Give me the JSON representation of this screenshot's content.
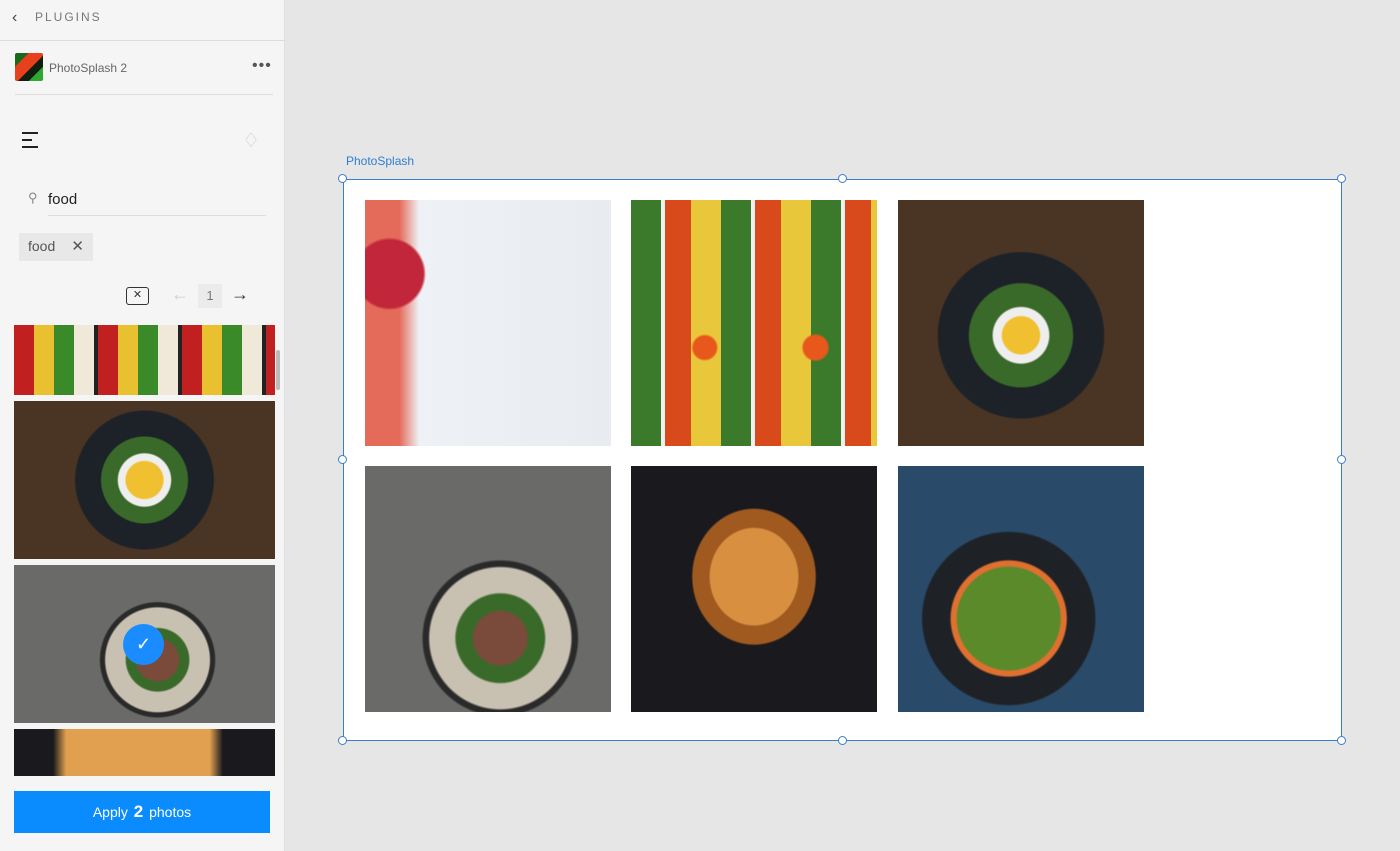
{
  "sidebar": {
    "back_label": "PLUGINS",
    "plugin_name": "PhotoSplash 2",
    "more_label": "•••",
    "search": {
      "value": "food",
      "placeholder": ""
    },
    "tags": [
      {
        "label": "food"
      }
    ],
    "pagination": {
      "current_page": "1"
    },
    "thumbnails": [
      {
        "selected": false
      },
      {
        "selected": false
      },
      {
        "selected": true
      },
      {
        "selected": false
      }
    ],
    "apply": {
      "prefix": "Apply",
      "count": "2",
      "suffix": "photos"
    }
  },
  "canvas": {
    "artboard_label": "PhotoSplash",
    "photos": [
      "colorful fruits flat lay",
      "vegetable salad bar",
      "egg avocado toast",
      "steak salad bowls",
      "french toast with blueberries",
      "salad plate"
    ]
  },
  "colors": {
    "accent": "#0a8cff",
    "selection": "#3a7ec8"
  }
}
